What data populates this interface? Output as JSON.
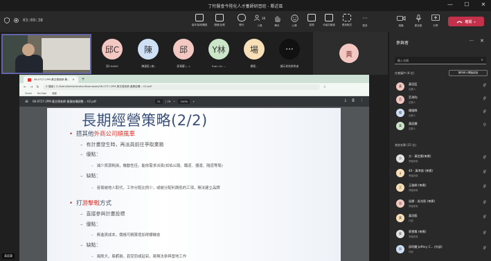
{
  "window": {
    "title": "丁桁醫會今陸化人才養師研習班 - 鄰近區",
    "controls": [
      "—",
      "☐",
      "✕"
    ]
  },
  "toolbar": {
    "timer": "03:09:38",
    "buttons": [
      {
        "label": "協作/接收職員",
        "icon": "window-icon"
      },
      {
        "label": "撥號/反應",
        "icon": "monitor-icon"
      },
      {
        "label": "聊天",
        "icon": "chat-icon"
      },
      {
        "label": "人員",
        "icon": "people-icon",
        "badge": "38"
      },
      {
        "label": "舉手",
        "icon": "hand-icon"
      },
      {
        "label": "心情",
        "icon": "emoji-icon"
      },
      {
        "label": "檢視",
        "icon": "grid-icon"
      },
      {
        "label": "分組討論室",
        "icon": "rooms-icon"
      },
      {
        "label": "應用程式",
        "icon": "apps-icon"
      },
      {
        "label": "更多",
        "icon": "more-icon"
      },
      {
        "label": "相機",
        "icon": "camera-icon"
      },
      {
        "label": "麥克風",
        "icon": "mic-icon"
      },
      {
        "label": "分享",
        "icon": "share-icon"
      }
    ],
    "leave_label": "離開"
  },
  "strip": {
    "self_label": "黃庭蘭",
    "participants": [
      {
        "initials": "邱C",
        "name": "邱CHANG",
        "color": "#f3c7c2"
      },
      {
        "initials": "陳",
        "name": "陳達鈺 (來)",
        "color": "#cfe0f5"
      },
      {
        "initials": "邱",
        "name": "邱資慶 (...)",
        "color": "#f3c7c2"
      },
      {
        "initials": "Y林",
        "name": "Yuan Lin ...",
        "color": "#cbe5c8"
      },
      {
        "initials": "場",
        "name": "僕場...",
        "color": "#f7dfb8"
      },
      {
        "initials": "···",
        "name": "顯示其他參與者",
        "color": "#111111"
      }
    ],
    "extra_initial": "黃"
  },
  "browser": {
    "tab_title": "06-0727-2PM-黃文德老師-黃...",
    "url": "① 檔案 | C:/Users/Administrator/Downloads/06-0727-2PM-黃文德老師-產業結構...-V2.pdf",
    "bookmarks": [
      "Gmail",
      "YouTube",
      "地圖"
    ],
    "pdf_filename": "06-0727-2PM-黃文德老師-產業結構調整...-V2.pdf",
    "page_current": "31",
    "page_total": "/ 79",
    "zoom": "100%"
  },
  "slide": {
    "title": "長期經營策略(2/2)",
    "l1a_pre": "搭其他",
    "l1a_red": "外商公司順風車",
    "l1a_l2a": "有計畫發生時，再派員前往爭取業務",
    "l1a_l2b": "優點：",
    "l1a_l3a": "減少資源耗損，機動性佳，能依需求派員(如佑公路、鐵道、捷運、隧道等局)",
    "l1a_l2c": "缺點：",
    "l1a_l3b": "容易被他人取代，工作分配比例少，或被分配利潤低的工項，無法建立品牌",
    "l1b_pre": "打",
    "l1b_red": "游擊戰",
    "l1b_post": "方式",
    "l1b_l2a": "直接參與計畫投標",
    "l1b_l2b": "優點：",
    "l1b_l3a": "無進資成本，價格可精算增加得標機會",
    "l1b_l2c": "缺點：",
    "l1b_l3b": "風險大，易虧損，若受罰或延宕，將無法參與當地工作"
  },
  "panel": {
    "title": "參與者",
    "search_placeholder": "輸入名稱",
    "section_in_meeting": "在會議中 (8 位)",
    "admit_all": "與所有人開始談話",
    "section_others": "其他名單 (25 位)",
    "people": [
      {
        "name": "黃冠臣",
        "role": "召集人",
        "initial": "黃",
        "color": "#f3c7c2",
        "mic": "muted"
      },
      {
        "name": "范承昀",
        "role": "召集人",
        "initial": "范",
        "color": "#f3c7c2",
        "mic": "muted"
      },
      {
        "name": "楊國興",
        "role": "召集人",
        "initial": "楊",
        "color": "#cfe0f5",
        "mic": "muted"
      },
      {
        "name": "黃庭蘭",
        "role": "召集人",
        "initial": "黃",
        "color": "#cbe5c8",
        "mic": "on"
      },
      {
        "name": "方 - 黃信惠(來賓)",
        "role": "會議來賓",
        "initial": "方",
        "color": "#e4e4e4",
        "mic": "muted"
      },
      {
        "name": "40 - 黃孝欽 (來賓)",
        "role": "會議來賓",
        "initial": "4",
        "color": "#f7dfb8",
        "mic": "muted"
      },
      {
        "name": "王雅卿 (來賓)",
        "role": "會議來賓",
        "initial": "王",
        "color": "#f7dfb8",
        "mic": "muted"
      },
      {
        "name": "吳鼎 - 吳兆晉 (來賓)",
        "role": "會議來賓",
        "initial": "吳",
        "color": "#f3c7c2",
        "mic": "muted"
      },
      {
        "name": "黃冠毅",
        "role": "外部",
        "initial": "黃",
        "color": "#f7dfb8",
        "mic": "muted"
      },
      {
        "name": "蔡雲舞 (來賓)",
        "role": "會議來賓",
        "initial": "蔡",
        "color": "#e4e4e4",
        "mic": "muted"
      },
      {
        "name": "邱明慶 Jeffery C... (外部)",
        "role": "外部",
        "initial": "邱",
        "color": "#cfe0f5",
        "mic": "muted"
      }
    ]
  }
}
